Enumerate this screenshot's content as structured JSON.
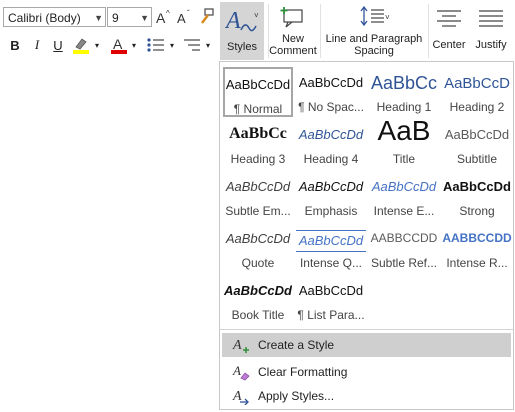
{
  "font": {
    "family": "Calibri (Body)",
    "size": "9"
  },
  "buttons": {
    "styles": "Styles",
    "new_comment_line1": "New",
    "new_comment_line2": "Comment",
    "line_para_line1": "Line and Paragraph",
    "line_para_line2": "Spacing",
    "center": "Center",
    "justify": "Justify"
  },
  "format_buttons": {
    "bold": "B",
    "italic": "I",
    "underline": "U",
    "font_color": "A"
  },
  "styles_gallery": [
    {
      "sample": "AaBbCcDd",
      "name": "¶ Normal",
      "selected": true
    },
    {
      "sample": "AaBbCcDd",
      "name": "¶ No Spac..."
    },
    {
      "sample": "AaBbCc",
      "name": "Heading 1"
    },
    {
      "sample": "AaBbCcD",
      "name": "Heading 2"
    },
    {
      "sample": "AaBbCc",
      "name": "Heading 3"
    },
    {
      "sample": "AaBbCcDd",
      "name": "Heading 4"
    },
    {
      "sample": "AaB",
      "name": "Title"
    },
    {
      "sample": "AaBbCcDd",
      "name": "Subtitle"
    },
    {
      "sample": "AaBbCcDd",
      "name": "Subtle Em..."
    },
    {
      "sample": "AaBbCcDd",
      "name": "Emphasis"
    },
    {
      "sample": "AaBbCcDd",
      "name": "Intense E..."
    },
    {
      "sample": "AaBbCcDd",
      "name": "Strong"
    },
    {
      "sample": "AaBbCcDd",
      "name": "Quote"
    },
    {
      "sample": "AaBbCcDd",
      "name": "Intense Q..."
    },
    {
      "sample": "AABBCCDD",
      "name": "Subtle Ref..."
    },
    {
      "sample": "AABBCCDD",
      "name": "Intense R..."
    },
    {
      "sample": "AaBbCcDd",
      "name": "Book Title"
    },
    {
      "sample": "AaBbCcDd",
      "name": "¶ List Para..."
    }
  ],
  "menu": {
    "create_style": "Create a Style",
    "clear_formatting": "Clear Formatting",
    "apply_styles": "Apply Styles..."
  },
  "colors": {
    "accent_blue": "#2f5496",
    "highlight_yellow": "#ffff00",
    "font_red": "#e00000",
    "hover_gray": "#cfcfcf"
  }
}
